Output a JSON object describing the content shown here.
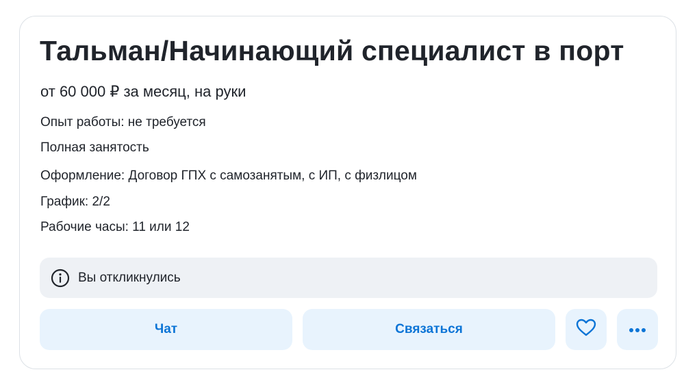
{
  "vacancy": {
    "title": "Тальман/Начинающий специалист в порт",
    "salary": "от 60 000 ₽ за месяц, на руки",
    "details": [
      "Опыт работы: не требуется",
      "Полная занятость",
      "Оформление: Договор ГПХ с самозанятым, с ИП, с физлицом",
      "График: 2/2",
      "Рабочие часы: 11 или 12"
    ]
  },
  "notice": {
    "icon": "info-icon",
    "text": "Вы откликнулись"
  },
  "actions": {
    "chat_label": "Чат",
    "contact_label": "Связаться",
    "favorite_icon": "heart-icon",
    "more_icon": "more-dots-icon"
  },
  "colors": {
    "accent": "#0b74d6",
    "button_bg": "#e8f3fd",
    "notice_bg": "#eef1f5",
    "text": "#20242b"
  }
}
